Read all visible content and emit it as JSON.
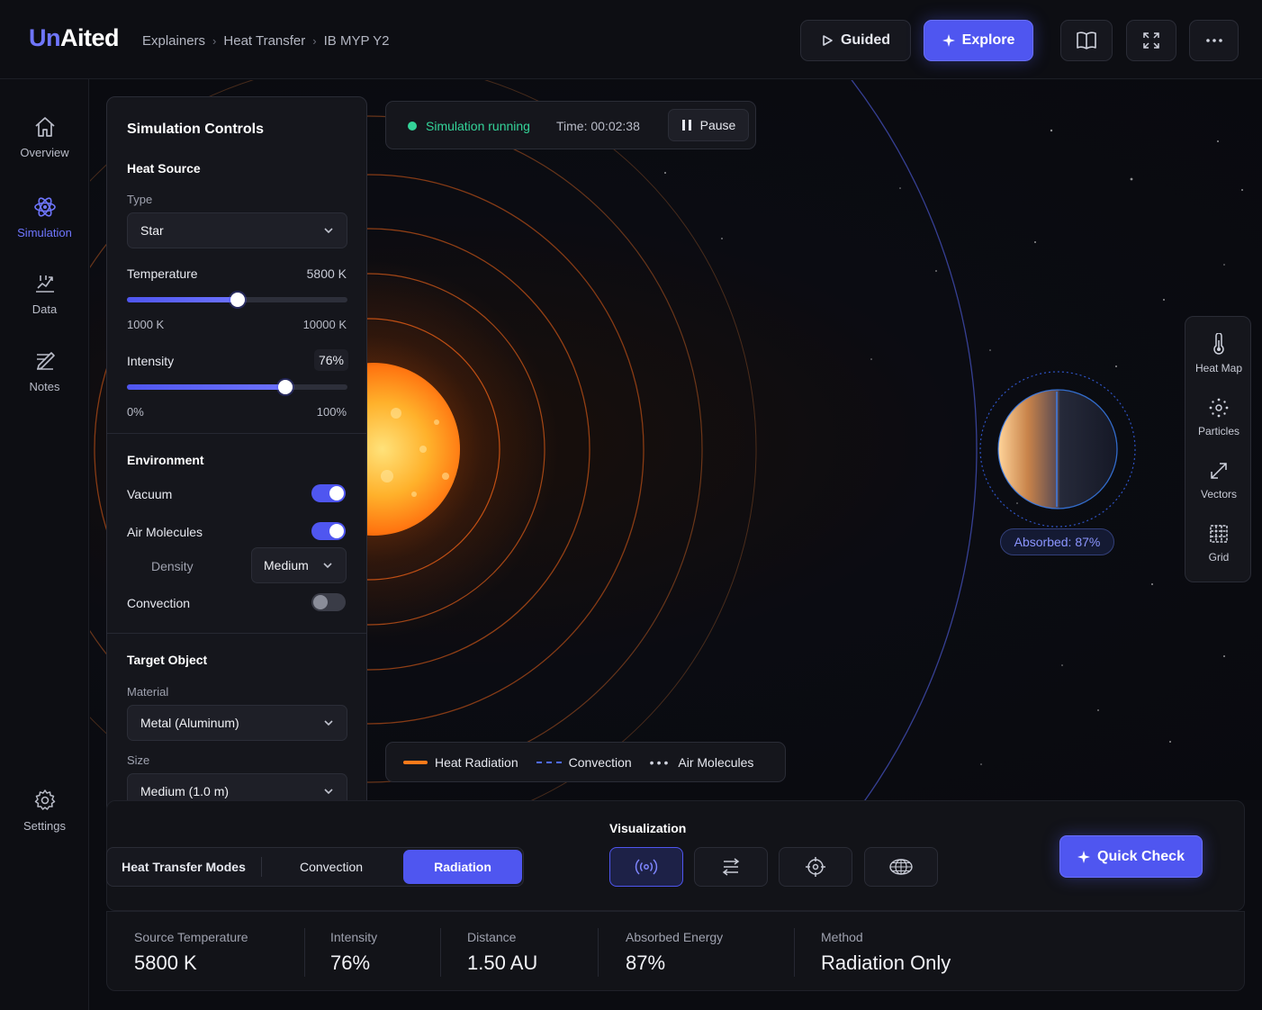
{
  "header": {
    "logo_accent": "Un",
    "logo_rest": "Aited",
    "breadcrumb": [
      "Explainers",
      "Heat Transfer",
      "IB MYP Y2"
    ],
    "guided_label": "Guided",
    "explore_label": "Explore"
  },
  "nav": {
    "items": [
      {
        "label": "Overview",
        "icon": "home-icon"
      },
      {
        "label": "Simulation",
        "icon": "atom-icon"
      },
      {
        "label": "Data",
        "icon": "chart-icon"
      },
      {
        "label": "Notes",
        "icon": "notes-icon"
      }
    ],
    "settings_label": "Settings"
  },
  "controls": {
    "title": "Simulation Controls",
    "heat_source": {
      "heading": "Heat Source",
      "type_label": "Type",
      "type_value": "Star",
      "temperature_label": "Temperature",
      "temperature_value": "5800 K",
      "temperature_min": "1000 K",
      "temperature_max": "10000 K",
      "temperature_fraction": 0.5,
      "intensity_label": "Intensity",
      "intensity_value": "76%",
      "intensity_min": "0%",
      "intensity_max": "100%",
      "intensity_fraction": 0.72
    },
    "environment": {
      "heading": "Environment",
      "vacuum_label": "Vacuum",
      "vacuum_on": true,
      "air_label": "Air Molecules",
      "air_on": true,
      "density_label": "Density",
      "density_value": "Medium",
      "convection_label": "Convection",
      "convection_on": false
    },
    "target": {
      "heading": "Target Object",
      "material_label": "Material",
      "material_value": "Metal (Aluminum)",
      "size_label": "Size",
      "size_value": "Medium (1.0 m)"
    }
  },
  "status": {
    "running_label": "Simulation running",
    "time_label": "Time: 00:02:38",
    "pause_label": "Pause"
  },
  "planet": {
    "absorbed_label": "Absorbed: 87%"
  },
  "tools": [
    {
      "label": "Heat Map",
      "icon": "thermometer-icon"
    },
    {
      "label": "Particles",
      "icon": "particles-icon"
    },
    {
      "label": "Vectors",
      "icon": "vectors-icon"
    },
    {
      "label": "Grid",
      "icon": "grid-icon"
    }
  ],
  "legend": {
    "radiation": "Heat Radiation",
    "convection": "Convection",
    "air": "Air Molecules"
  },
  "modes": {
    "title": "Heat Transfer Modes",
    "convection": "Convection",
    "radiation": "Radiation"
  },
  "visualization": {
    "title": "Visualization",
    "quick_check": "Quick Check"
  },
  "stats": [
    {
      "label": "Source Temperature",
      "value": "5800 K"
    },
    {
      "label": "Intensity",
      "value": "76%"
    },
    {
      "label": "Distance",
      "value": "1.50 AU"
    },
    {
      "label": "Absorbed Energy",
      "value": "87%"
    },
    {
      "label": "Method",
      "value": "Radiation Only"
    }
  ],
  "colors": {
    "accent": "#4f56f0",
    "accent_light": "#6f76ff",
    "running": "#34d399",
    "radiation": "#ff7a1a",
    "planet_ring": "#3b82f6"
  }
}
